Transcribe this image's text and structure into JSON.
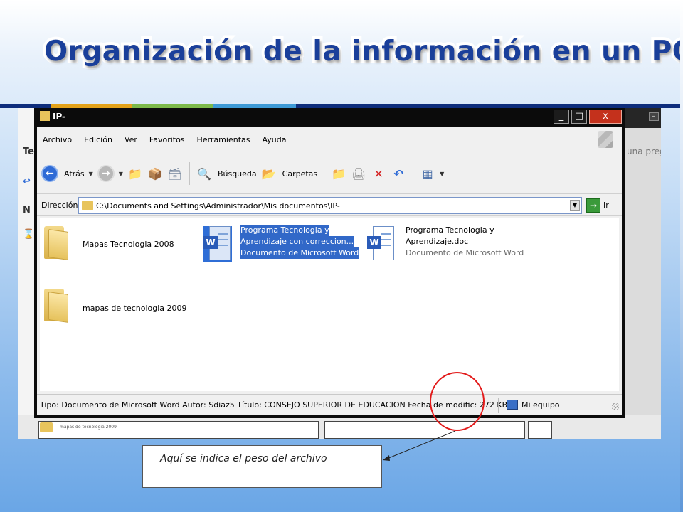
{
  "slide": {
    "title": "Organización de la información en un PC",
    "annotation": "Aquí se indica el peso del archivo"
  },
  "window": {
    "title": "IP-",
    "buttons": [
      "_",
      "□",
      "x"
    ]
  },
  "menu": [
    "Archivo",
    "Edición",
    "Ver",
    "Favoritos",
    "Herramientas",
    "Ayuda"
  ],
  "toolbar": {
    "back_label": "Atrás",
    "search_label": "Búsqueda",
    "folders_label": "Carpetas"
  },
  "address": {
    "label": "Dirección",
    "value": "C:\\Documents and Settings\\Administrador\\Mis documentos\\IP-",
    "go_label": "Ir"
  },
  "items": {
    "folder1": "Mapas Tecnologia 2008",
    "folder2": "mapas de tecnologia 2009",
    "doc1_line1": "Programa Tecnologia y",
    "doc1_line2": "Aprendizaje con correccion...",
    "doc1_type": "Documento de Microsoft Word",
    "doc2_line1": "Programa Tecnologia y",
    "doc2_line2": "Aprendizaje.doc",
    "doc2_type": "Documento de Microsoft Word"
  },
  "status": {
    "text": "Tipo: Documento de Microsoft Word Autor: Sdiaz5 Título: CONSEJO SUPERIOR DE EDUCACION Fecha de modific: 272 KB",
    "location": "Mi equipo"
  },
  "background": {
    "side_glyphs": [
      "Te",
      "↩",
      "N",
      "⌛"
    ],
    "right_text": "una preg",
    "mini_folder_label": "mapas de tecnologia 2009"
  },
  "colors": {
    "title": "#1a3f9a",
    "highlight": "#e21a1a",
    "selection": "#3168c8"
  }
}
